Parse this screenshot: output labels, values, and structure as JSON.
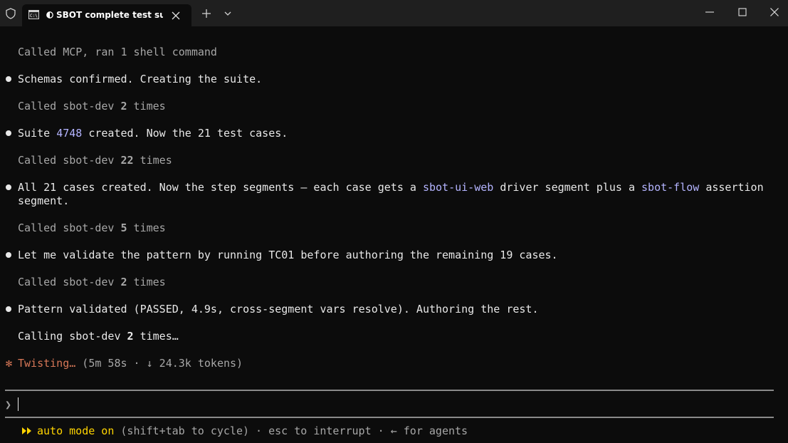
{
  "window": {
    "tab_title": "SBOT complete test suite fo",
    "tab_title_tooltip": "SBOT complete test suite for"
  },
  "icons": {
    "shield": "shield-icon",
    "terminal": "terminal-icon",
    "status": "half-circle-icon",
    "close": "close-icon",
    "new_tab": "plus-icon",
    "dropdown": "chevron-down-icon",
    "minimize": "minimize-icon",
    "maximize": "maximize-icon",
    "window_close": "close-icon"
  },
  "colors": {
    "accent": "#d77757",
    "highlight": "#b4b4ff",
    "status_yellow": "#ffd400"
  },
  "transcript": {
    "l1": "Called MCP, ran 1 shell command",
    "l2": "Schemas confirmed. Creating the suite.",
    "l3a": "Called sbot-dev ",
    "l3b": "2",
    "l3c": " times",
    "l4a": "Suite ",
    "l4b": "4748",
    "l4c": " created. Now the 21 test cases.",
    "l5a": "Called sbot-dev ",
    "l5b": "22",
    "l5c": " times",
    "l6a": "All 21 cases created. Now the step segments — each case gets a ",
    "l6b": "sbot-ui-web",
    "l6c": " driver segment plus a ",
    "l6d": "sbot-flow",
    "l6e": " assertion",
    "l6f": "segment.",
    "l7a": "Called sbot-dev ",
    "l7b": "5",
    "l7c": " times",
    "l8": "Let me validate the pattern by running TC01 before authoring the remaining 19 cases.",
    "l9a": "Called sbot-dev ",
    "l9b": "2",
    "l9c": " times",
    "l10": "Pattern validated (PASSED, 4.9s, cross-segment vars resolve). Authoring the rest.",
    "l11a": "Calling sbot-dev ",
    "l11b": "2",
    "l11c": " times…"
  },
  "spinner": {
    "glyph": "✻",
    "label": "Twisting…",
    "meta": " (5m 58s · ↓ 24.3k tokens)"
  },
  "prompt": {
    "glyph": "❯",
    "value": ""
  },
  "status_bar": {
    "mode": "auto mode on",
    "rest": " (shift+tab to cycle) · esc to interrupt · ← for agents"
  }
}
